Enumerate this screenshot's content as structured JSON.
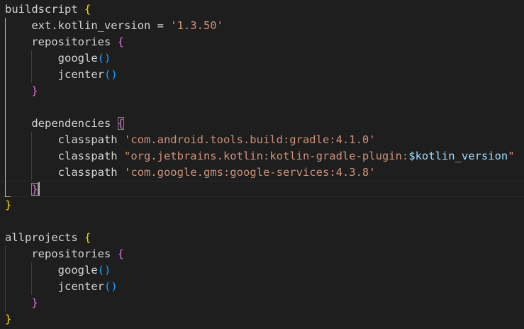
{
  "editor": {
    "language": "gradle",
    "theme_colors": {
      "background": "#1e1e1e",
      "plain": "#d4d4d4",
      "string": "#ce9178",
      "variable": "#9cdcfe",
      "bracket_level1": "#ffd700",
      "bracket_level2": "#da70d6",
      "bracket_level3": "#179fff",
      "indent_guide": "#404040",
      "active_indent_guide": "#d7ba7d"
    },
    "lines": [
      {
        "tokens": [
          {
            "t": "buildscript ",
            "c": "plain"
          },
          {
            "t": "{",
            "c": "b1"
          }
        ]
      },
      {
        "tokens": [
          {
            "t": "    ext.kotlin_version = ",
            "c": "plain"
          },
          {
            "t": "'1.3.50'",
            "c": "str"
          }
        ]
      },
      {
        "tokens": [
          {
            "t": "    repositories ",
            "c": "plain"
          },
          {
            "t": "{",
            "c": "b2"
          }
        ]
      },
      {
        "tokens": [
          {
            "t": "        google",
            "c": "plain"
          },
          {
            "t": "()",
            "c": "b3"
          }
        ]
      },
      {
        "tokens": [
          {
            "t": "        jcenter",
            "c": "plain"
          },
          {
            "t": "()",
            "c": "b3"
          }
        ]
      },
      {
        "tokens": [
          {
            "t": "    ",
            "c": "plain"
          },
          {
            "t": "}",
            "c": "b2"
          }
        ]
      },
      {
        "tokens": []
      },
      {
        "tokens": [
          {
            "t": "    dependencies ",
            "c": "plain"
          },
          {
            "t": "{",
            "c": "b2",
            "match": true
          }
        ]
      },
      {
        "tokens": [
          {
            "t": "        classpath ",
            "c": "plain"
          },
          {
            "t": "'com.android.tools.build:gradle:4.1.0'",
            "c": "str"
          }
        ]
      },
      {
        "tokens": [
          {
            "t": "        classpath ",
            "c": "plain"
          },
          {
            "t": "\"org.jetbrains.kotlin:kotlin-gradle-plugin:",
            "c": "str"
          },
          {
            "t": "$kotlin_version",
            "c": "var"
          },
          {
            "t": "\"",
            "c": "str"
          }
        ]
      },
      {
        "tokens": [
          {
            "t": "        classpath ",
            "c": "plain"
          },
          {
            "t": "'com.google.gms:google-services:4.3.8'",
            "c": "str"
          }
        ]
      },
      {
        "tokens": [
          {
            "t": "    ",
            "c": "plain"
          },
          {
            "t": "}",
            "c": "b2",
            "match": true
          }
        ],
        "current": true
      },
      {
        "tokens": [
          {
            "t": "}",
            "c": "b1"
          }
        ]
      },
      {
        "tokens": []
      },
      {
        "tokens": [
          {
            "t": "allprojects ",
            "c": "plain"
          },
          {
            "t": "{",
            "c": "b1"
          }
        ]
      },
      {
        "tokens": [
          {
            "t": "    repositories ",
            "c": "plain"
          },
          {
            "t": "{",
            "c": "b2"
          }
        ]
      },
      {
        "tokens": [
          {
            "t": "        google",
            "c": "plain"
          },
          {
            "t": "()",
            "c": "b3"
          }
        ]
      },
      {
        "tokens": [
          {
            "t": "        jcenter",
            "c": "plain"
          },
          {
            "t": "()",
            "c": "b3"
          }
        ]
      },
      {
        "tokens": [
          {
            "t": "    ",
            "c": "plain"
          },
          {
            "t": "}",
            "c": "b2"
          }
        ]
      },
      {
        "tokens": [
          {
            "t": "}",
            "c": "b1"
          }
        ]
      }
    ]
  }
}
